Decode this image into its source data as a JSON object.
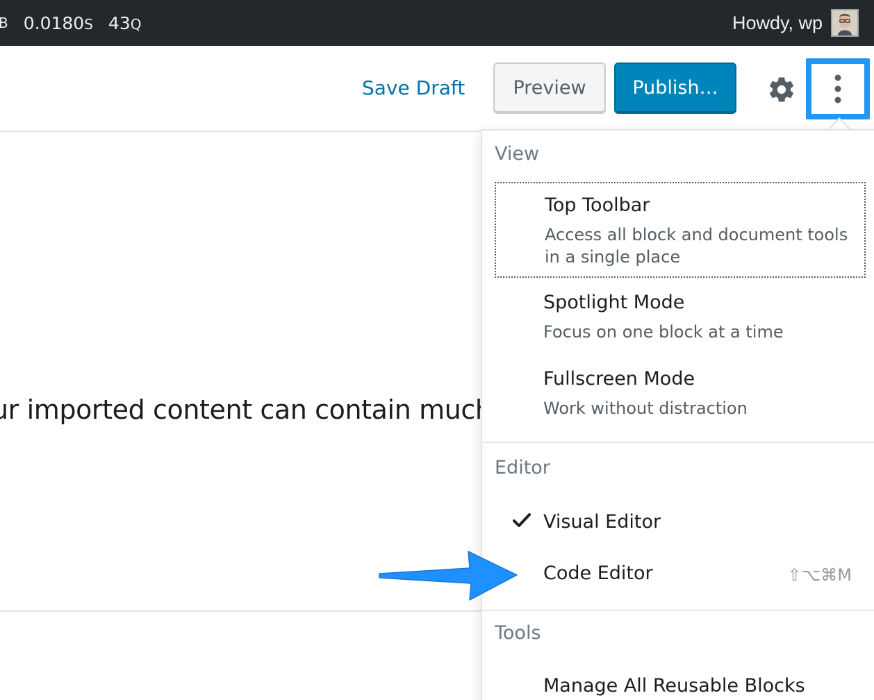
{
  "admin_bar": {
    "stat_b": "B",
    "time_value": "0.0180",
    "time_unit": "S",
    "queries_value": "43",
    "queries_unit": "Q",
    "howdy": "Howdy, wp"
  },
  "header": {
    "save_draft": "Save Draft",
    "preview": "Preview",
    "publish": "Publish…"
  },
  "content": {
    "text": "ur imported content can contain much more"
  },
  "menu": {
    "view_label": "View",
    "view_items": [
      {
        "title": "Top Toolbar",
        "desc_line1": "Access all block and document tools",
        "desc_line2": "in a single place"
      },
      {
        "title": "Spotlight Mode",
        "desc_line1": "Focus on one block at a time"
      },
      {
        "title": "Fullscreen Mode",
        "desc_line1": "Work without distraction"
      }
    ],
    "editor_label": "Editor",
    "editor_items": [
      {
        "title": "Visual Editor",
        "checked": true
      },
      {
        "title": "Code Editor",
        "shortcut": "⇧⌥⌘M"
      }
    ],
    "tools_label": "Tools",
    "tools_items": [
      {
        "title": "Manage All Reusable Blocks"
      }
    ]
  },
  "colors": {
    "accent": "#0085ba",
    "link": "#0073aa",
    "highlight": "#2196f3",
    "adminbar": "#23282d"
  },
  "icons": [
    "user-avatar",
    "gear-icon",
    "more-vertical-icon",
    "checkmark-icon",
    "blue-arrow-annotation"
  ]
}
